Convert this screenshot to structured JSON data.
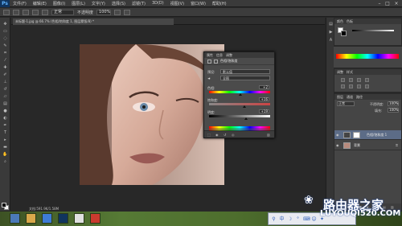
{
  "app": {
    "logo": "Ps"
  },
  "menu": [
    "文件(F)",
    "编辑(E)",
    "图像(I)",
    "图层(L)",
    "文字(Y)",
    "选择(S)",
    "滤镜(T)",
    "3D(D)",
    "视图(V)",
    "窗口(W)",
    "帮助(H)"
  ],
  "options_bar": {
    "mode_label": "正常",
    "opacity_label": "不透明度",
    "opacity_value": "100%"
  },
  "document": {
    "tab_label": "未标题-1.jpg @ 66.7% (色相/饱和度 1, 图层蒙版/8) *"
  },
  "status_bar": {
    "text": "文档:591.9K/1.58M"
  },
  "adjustment_dialog": {
    "tabs": [
      "属性",
      "信息",
      "调整"
    ],
    "title": "色相/饱和度",
    "preset_label": "预设:",
    "preset_value": "默认值",
    "channel_value": "全图",
    "hue_label": "色相:",
    "hue_value": "+2",
    "saturation_label": "饱和度:",
    "saturation_value": "+16",
    "lightness_label": "明度:",
    "lightness_value": "+19",
    "hue_knob": 0.51,
    "saturation_knob": 0.58,
    "lightness_knob": 0.6
  },
  "right_panels": {
    "color_tabs": [
      "颜色",
      "色板"
    ],
    "adjust_tabs": [
      "调整",
      "样式"
    ],
    "layers_tabs": [
      "图层",
      "通道",
      "路径"
    ],
    "blend_mode": "正常",
    "opacity_label": "不透明度:",
    "opacity_value": "100%",
    "fill_label": "填充:",
    "fill_value": "100%",
    "layers": [
      {
        "name": "色相/饱和度 1"
      },
      {
        "name": "背景"
      }
    ]
  },
  "watermark": {
    "brand": "路由器之家",
    "url": "LUYOUQI520.COM"
  },
  "colors": {
    "workspace": "#282828",
    "panel": "#454545",
    "accent": "#2b5cb8",
    "foreground": "#000000",
    "background": "#ffffff"
  }
}
